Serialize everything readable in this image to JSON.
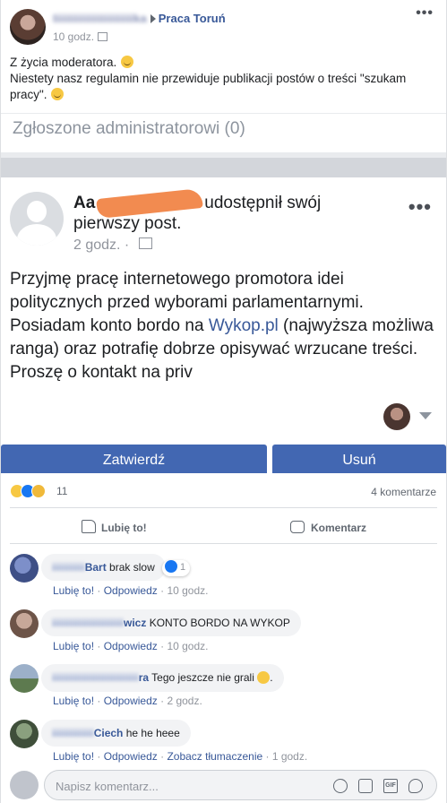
{
  "post1": {
    "author": "Iiiiiiiiiiiiiiiiiiiiiiiiika",
    "group": "Praca Toruń",
    "time": "10 godz.",
    "line1": "Z życia moderatora.",
    "line2": "Niestety nasz regulamin nie przewiduje publikacji postów o treści \"szukam pracy\".",
    "reported": "Zgłoszone administratorowi (0)"
  },
  "post2": {
    "author": "Aa",
    "header_suffix": "udostępnił swój pierwszy post.",
    "time": "2 godz.",
    "body_before": "Przyjmę pracę internetowego promotora idei politycznych przed wyborami parlamentarnymi. Posiadam konto bordo na ",
    "link": "Wykop.pl",
    "body_after": " (najwyższa możliwa ranga) oraz potrafię dobrze opisywać wrzucane treści. Proszę o kontakt na priv",
    "approve_label": "Zatwierdź",
    "remove_label": "Usuń",
    "reactions_count": "11",
    "comments_count": "4 komentarze",
    "like_action": "Lubię to!",
    "comment_action": "Komentarz"
  },
  "comments": [
    {
      "name_blur": "iiiiiiiiiii",
      "name_tail": "Bart",
      "text": "brak slow",
      "likes": "1",
      "like_label": "Lubię to!",
      "reply_label": "Odpowiedz",
      "time": "10 godz."
    },
    {
      "name_blur": "iiiiiiiiiiiiiiiiiiiiiiii",
      "name_tail": "wicz",
      "text": "KONTO BORDO NA WYKOP",
      "like_label": "Lubię to!",
      "reply_label": "Odpowiedz",
      "time": "10 godz."
    },
    {
      "name_blur": "iiiiiiiiiiiiiiiiiiiiiiiiiiiii",
      "name_tail": "ra",
      "text": "Tego jeszcze nie grali",
      "like_label": "Lubię to!",
      "reply_label": "Odpowiedz",
      "time": "2 godz."
    },
    {
      "name_blur": "iiiiiiiiiiiiii",
      "name_tail": "Ciech",
      "text": "he he heee",
      "like_label": "Lubię to!",
      "reply_label": "Odpowiedz",
      "translate_label": "Zobacz tłumaczenie",
      "time": "1 godz."
    }
  ],
  "composer": {
    "placeholder": "Napisz komentarz...",
    "gif_label": "GIF",
    "icons": [
      "emoji-icon",
      "camera-icon",
      "gif-icon",
      "sticker-icon"
    ]
  },
  "colors": {
    "primary_button": "#4267b2",
    "link": "#385898",
    "feed_background": "#e9ebee"
  }
}
